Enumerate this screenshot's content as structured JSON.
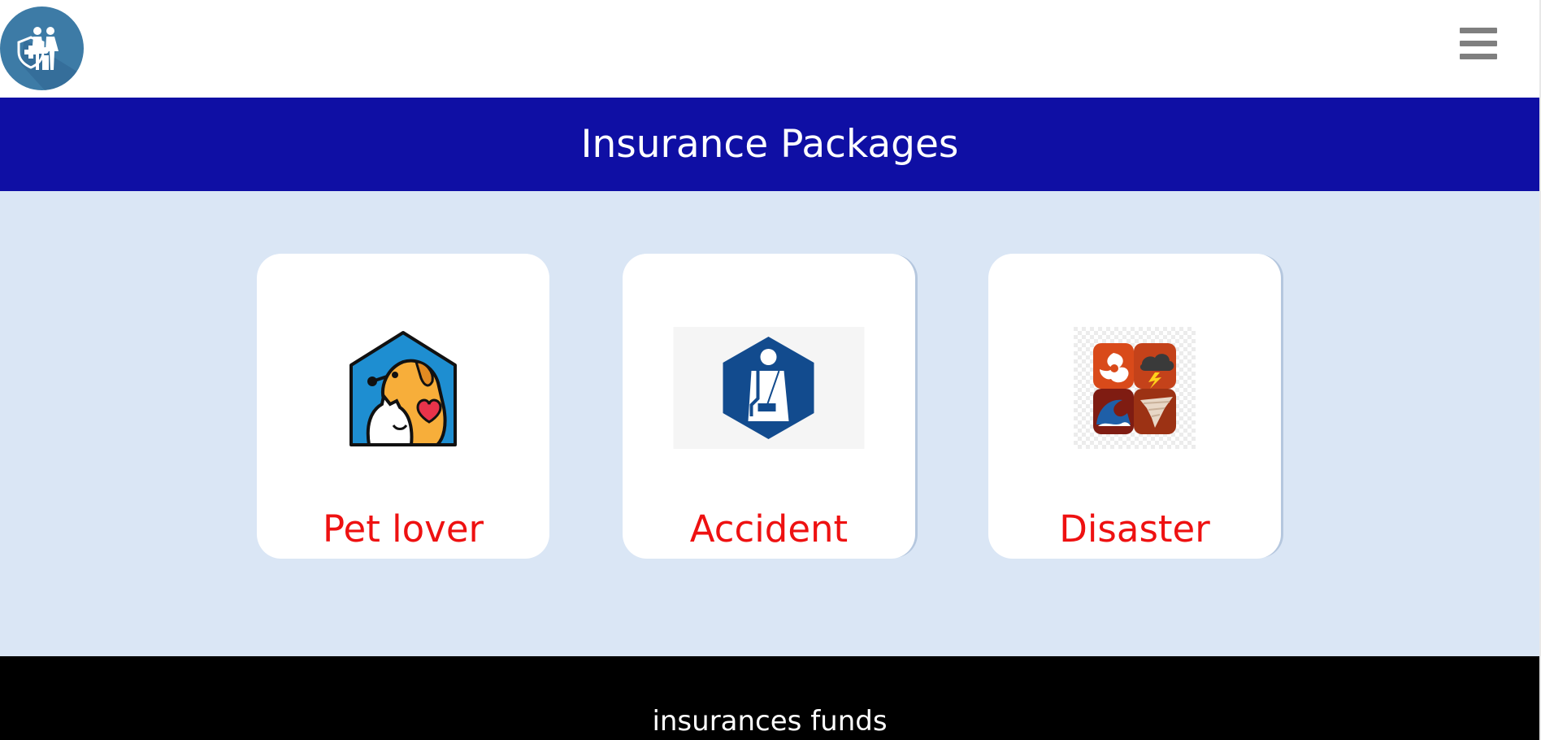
{
  "header": {
    "logo_icon": "family-shield-icon",
    "menu_icon": "hamburger-menu-icon"
  },
  "banner": {
    "title": "Insurance Packages"
  },
  "packages": [
    {
      "label": "Pet lover",
      "icon": "pet-house-icon"
    },
    {
      "label": "Accident",
      "icon": "injured-person-hexagon-icon"
    },
    {
      "label": "Disaster",
      "icon": "natural-disasters-icon"
    }
  ],
  "footer": {
    "text": "insurances funds"
  },
  "colors": {
    "banner_bg": "#0f0fa4",
    "content_bg": "#dae6f5",
    "label_red": "#ee1111",
    "footer_bg": "#000000"
  }
}
